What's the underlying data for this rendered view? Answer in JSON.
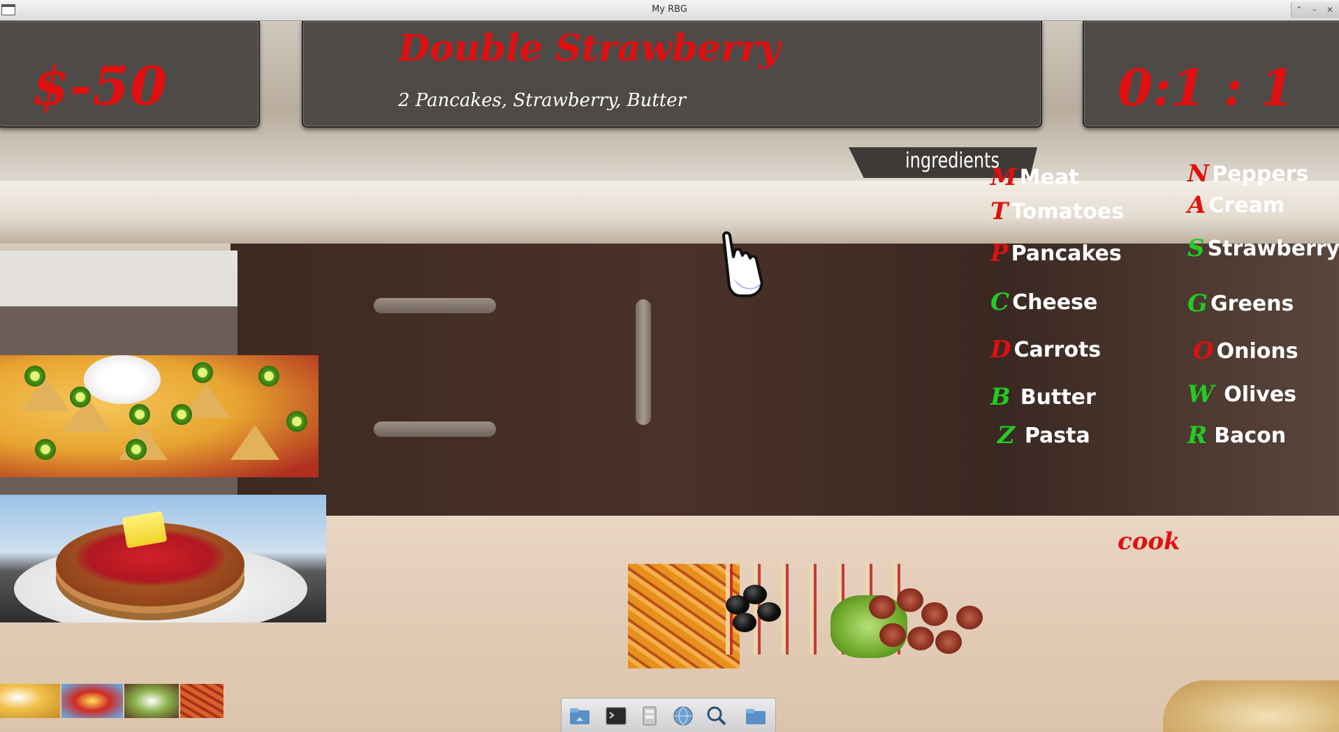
{
  "window": {
    "title": "My RBG"
  },
  "hud": {
    "money": "$-50",
    "recipe_name": "Double Strawberry",
    "recipe_ingredients": "2 Pancakes, Strawberry, Butter",
    "timer": "0:1 : 1",
    "ingredients_tab": "ingredients",
    "cook_label": "cook"
  },
  "ingredients": [
    {
      "key": "M",
      "name": "Meat",
      "key_color": "#e01010"
    },
    {
      "key": "N",
      "name": "Peppers",
      "key_color": "#e01010"
    },
    {
      "key": "T",
      "name": "Tomatoes",
      "key_color": "#e01010"
    },
    {
      "key": "A",
      "name": "Cream",
      "key_color": "#e01010"
    },
    {
      "key": "P",
      "name": "Pancakes",
      "key_color": "#e01010"
    },
    {
      "key": "S",
      "name": "Strawberry",
      "key_color": "#22cc22"
    },
    {
      "key": "C",
      "name": "Cheese",
      "key_color": "#22cc22"
    },
    {
      "key": "G",
      "name": "Greens",
      "key_color": "#22cc22"
    },
    {
      "key": "D",
      "name": "Carrots",
      "key_color": "#e01010"
    },
    {
      "key": "O",
      "name": "Onions",
      "key_color": "#e01010"
    },
    {
      "key": "B",
      "name": "Butter",
      "key_color": "#22cc22"
    },
    {
      "key": "W",
      "name": "Olives",
      "key_color": "#22cc22"
    },
    {
      "key": "Z",
      "name": "Pasta",
      "key_color": "#22cc22"
    },
    {
      "key": "R",
      "name": "Bacon",
      "key_color": "#22cc22"
    }
  ],
  "orders": [
    {
      "icon": "nachos-image"
    },
    {
      "icon": "pancake-image"
    }
  ],
  "dock": {
    "items": [
      {
        "icon": "home-folder-icon"
      },
      {
        "icon": "terminal-icon"
      },
      {
        "icon": "file-manager-icon"
      },
      {
        "icon": "browser-globe-icon"
      },
      {
        "icon": "search-icon"
      },
      {
        "icon": "folder-icon"
      }
    ]
  },
  "colors": {
    "accent_red": "#e01010",
    "accent_green": "#22cc22",
    "panel": "#4d4a47"
  }
}
